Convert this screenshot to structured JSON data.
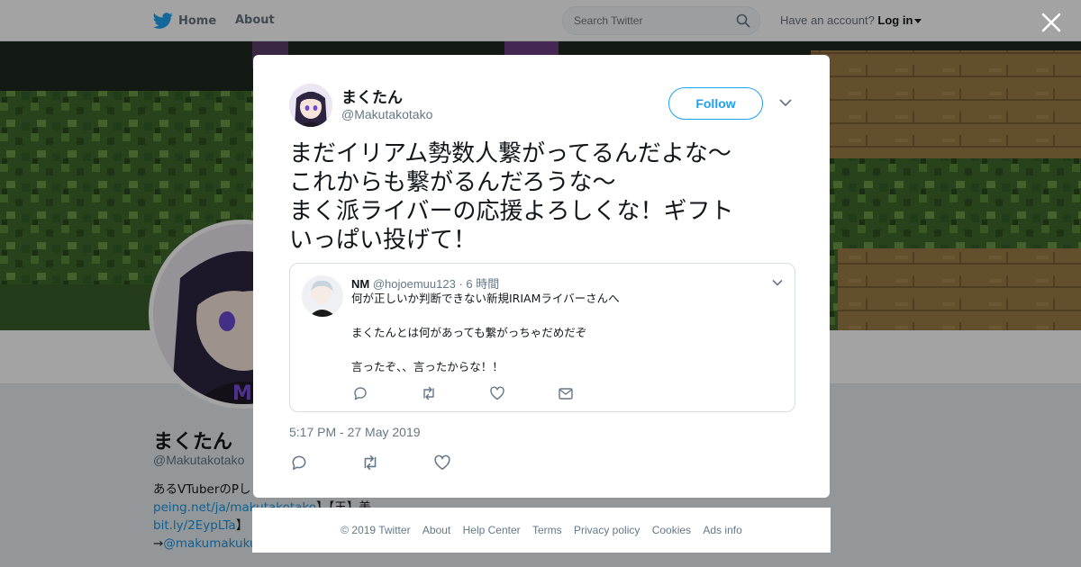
{
  "header": {
    "home_label": "Home",
    "about_label": "About",
    "search_placeholder": "Search Twitter",
    "account_prompt": "Have an account?",
    "login_label": "Log in"
  },
  "profile": {
    "name": "まくたん",
    "handle": "@Makutakotako",
    "bio_line1": "あるVTuberのPし",
    "bio_link1": "peing.net/ja/makutakotako",
    "bio_after1": "】【王】美",
    "bio_link2": "bit.ly/2EypLTa",
    "bio_after2": "】",
    "bio_arrow": "→",
    "bio_link3": "@makumakuku"
  },
  "tweet": {
    "author_name": "まくたん",
    "author_handle": "@Makutakotako",
    "follow_label": "Follow",
    "text_lines": [
      "まだイリアム勢数人繋がってるんだよな～",
      "これからも繋がるんだろうな～",
      "まく派ライバーの応援よろしくな！ギフト",
      "いっぱい投げて！"
    ],
    "timestamp": "5:17 PM - 27 May 2019"
  },
  "quoted": {
    "name": "NM",
    "handle": "@hojoemuu123",
    "time": "· 6 時間",
    "line1": "何が正しいか判断できない新規IRIAMライバーさんへ",
    "line2": "まくたんとは何があっても繋がっちゃだめだぞ",
    "line3": "言ったぞ、、言ったからな！！"
  },
  "footer": {
    "copyright": "© 2019 Twitter",
    "about": "About",
    "help": "Help Center",
    "terms": "Terms",
    "privacy": "Privacy policy",
    "cookies": "Cookies",
    "ads": "Ads info"
  },
  "colors": {
    "accent": "#1da1f2",
    "link": "#1b95e0",
    "secondary_text": "#657786",
    "overlay": "rgba(0,0,0,0.36)"
  },
  "icons": [
    "twitter-bird-icon",
    "search-icon",
    "close-icon",
    "chevron-down-icon",
    "reply-icon",
    "retweet-icon",
    "like-icon",
    "dm-icon"
  ]
}
